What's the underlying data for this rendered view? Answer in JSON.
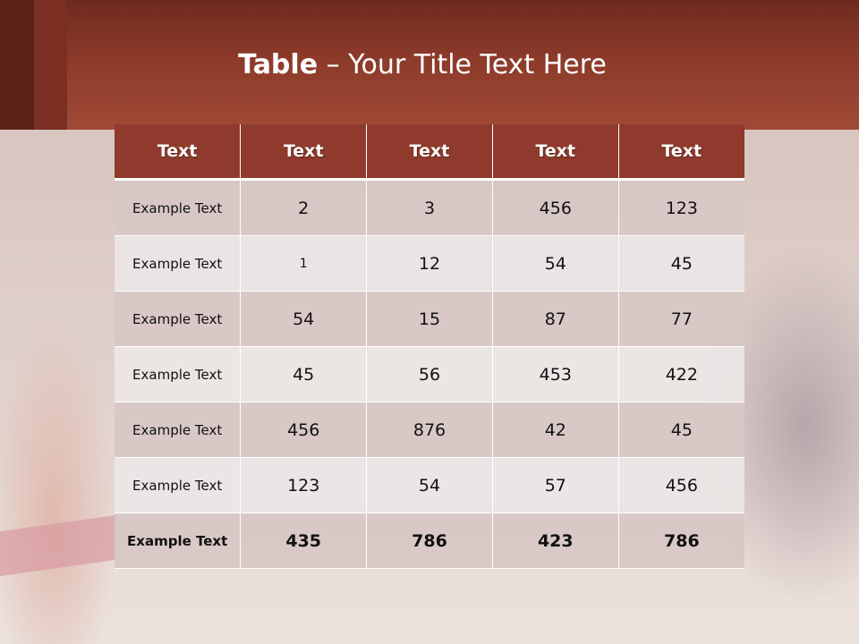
{
  "title": {
    "bold": "Table",
    "rest": " – Your Title Text Here"
  },
  "table": {
    "headers": [
      "Text",
      "Text",
      "Text",
      "Text",
      "Text"
    ],
    "rows": [
      [
        "Example Text",
        "2",
        "3",
        "456",
        "123"
      ],
      [
        "Example Text",
        "1",
        "12",
        "54",
        "45"
      ],
      [
        "Example Text",
        "54",
        "15",
        "87",
        "77"
      ],
      [
        "Example Text",
        "45",
        "56",
        "453",
        "422"
      ],
      [
        "Example Text",
        "456",
        "876",
        "42",
        "45"
      ],
      [
        "Example Text",
        "123",
        "54",
        "57",
        "456"
      ],
      [
        "Example Text",
        "435",
        "786",
        "423",
        "786"
      ]
    ]
  },
  "colors": {
    "header_bar": "#8f3a2c",
    "banner": "#a04a36",
    "row_odd": "#d7c8c6",
    "row_even": "#ece6e6"
  }
}
